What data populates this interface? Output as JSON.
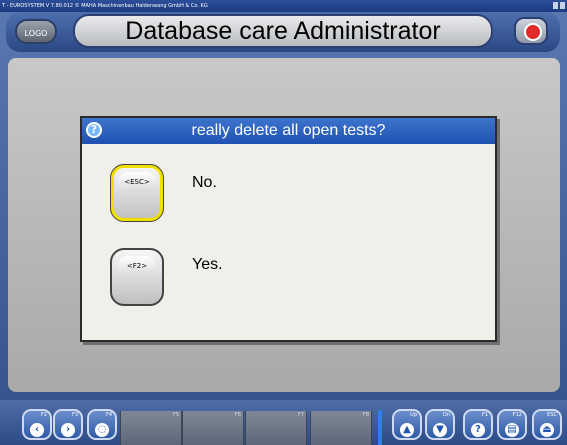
{
  "window": {
    "titlebar_text": "T - EUROSYSTEM  V 7.80.012  © MAHA Maschinenbau Haldenwang GmbH & Co. KG"
  },
  "header": {
    "logo_label": "LOGO",
    "title": "Database care Administrator"
  },
  "dialog": {
    "title": "really delete all open tests?",
    "help_glyph": "?",
    "options": [
      {
        "key": "<ESC>",
        "label": "No.",
        "selected": true
      },
      {
        "key": "<F2>",
        "label": "Yes.",
        "selected": false
      }
    ]
  },
  "bottom_bar": {
    "fkeys_left": [
      {
        "label": "F2",
        "icon": "back-icon",
        "glyph": "‹"
      },
      {
        "label": "F3",
        "icon": "forward-icon",
        "glyph": "›"
      },
      {
        "label": "F4",
        "icon": "network-icon",
        "glyph": "◌"
      }
    ],
    "slots": [
      {
        "label": "F5"
      },
      {
        "label": "F6"
      },
      {
        "label": "F7"
      },
      {
        "label": "F8"
      }
    ],
    "fkeys_right": [
      {
        "label": "Up",
        "icon": "up-icon",
        "glyph": "▲"
      },
      {
        "label": "Dn",
        "icon": "down-icon",
        "glyph": "▼"
      },
      {
        "label": "F1",
        "icon": "help-icon",
        "glyph": "?"
      },
      {
        "label": "F12",
        "icon": "print-icon",
        "glyph": "▤"
      },
      {
        "label": "ESC",
        "icon": "exit-icon",
        "glyph": "⏏"
      }
    ]
  }
}
